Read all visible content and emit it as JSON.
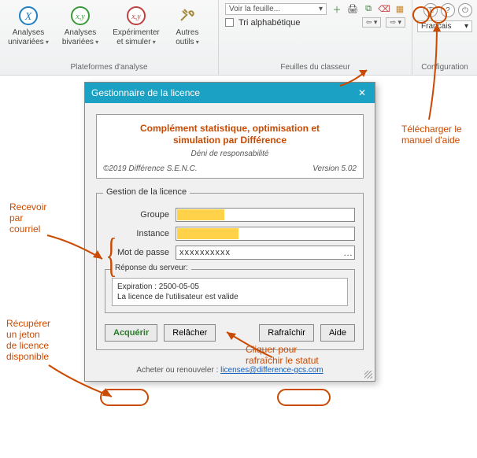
{
  "ribbon": {
    "groups": {
      "platforms": {
        "caption": "Plateformes d'analyse",
        "buttons": {
          "univariate": "Analyses univariées",
          "bivariate": "Analyses bivariées",
          "experiment": "Expérimenter et simuler",
          "other": "Autres outils"
        }
      },
      "sheets": {
        "caption": "Feuilles du classeur",
        "selector_label": "Voir la feuille...",
        "alpha_sort": "Tri alphabétique"
      },
      "config": {
        "caption": "Configuration",
        "language": "Francais"
      }
    }
  },
  "dialog": {
    "title": "Gestionnaire de la licence",
    "header": {
      "title_l1": "Complément statistique, optimisation et",
      "title_l2": "simulation par Différence",
      "disclaimer": "Déni de responsabilité",
      "copyright": "©2019 Différence S.E.N.C.",
      "version": "Version 5.02"
    },
    "fieldset": {
      "legend": "Gestion de la licence",
      "labels": {
        "group": "Groupe",
        "instance": "Instance",
        "password": "Mot de passe"
      },
      "values": {
        "group": "",
        "instance": "",
        "password_mask": "xxxxxxxxxx"
      }
    },
    "response": {
      "legend": "Réponse du serveur:",
      "line1": "Expiration : 2500-05-05",
      "line2": "La licence de l'utilisateur est valide"
    },
    "buttons": {
      "acquire": "Acquérir",
      "release": "Relâcher",
      "refresh": "Rafraîchir",
      "help": "Aide"
    },
    "footer": {
      "prefix": "Acheter ou renouveler : ",
      "email": "licenses@difference-gcs.com"
    }
  },
  "annotations": {
    "download_help_l1": "Télécharger le",
    "download_help_l2": "manuel d'aide",
    "receive_l1": "Recevoir",
    "receive_l2": "par",
    "receive_l3": "courriel",
    "retrieve_l1": "Récupérer",
    "retrieve_l2": "un jeton",
    "retrieve_l3": "de licence",
    "retrieve_l4": "disponible",
    "refresh_l1": "Cliquer pour",
    "refresh_l2": "rafraîchir le statut"
  }
}
